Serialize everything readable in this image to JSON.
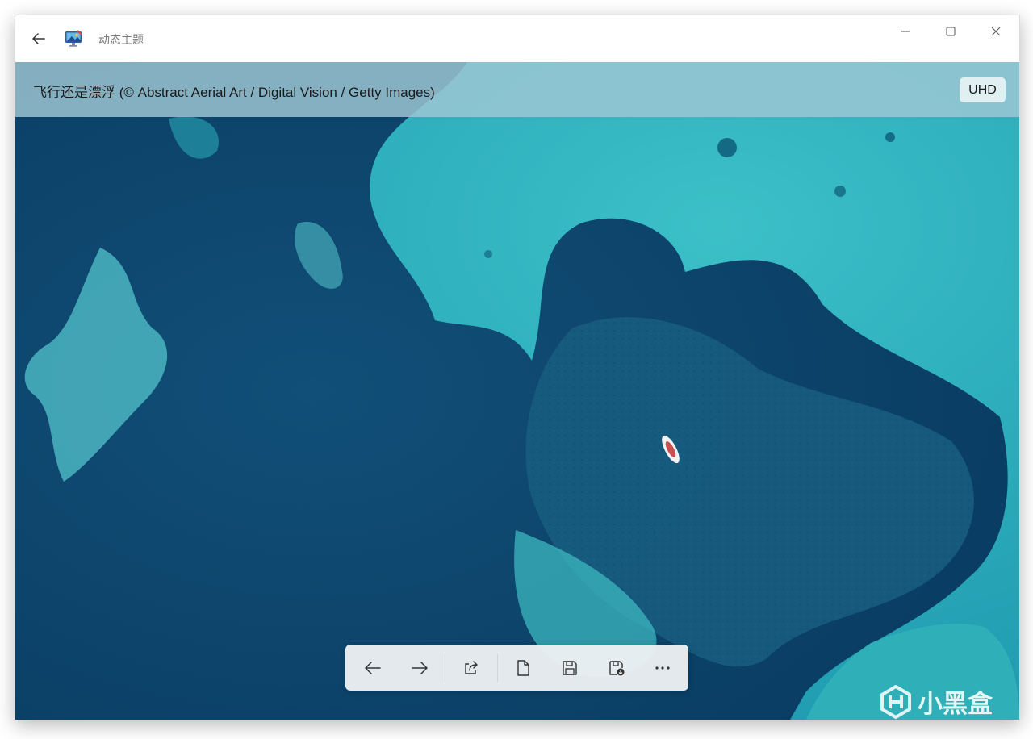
{
  "window": {
    "title": "动态主题"
  },
  "image_info": {
    "title": "飞行还是漂浮 (© Abstract Aerial Art / Digital Vision / Getty Images)",
    "badge": "UHD"
  },
  "toolbar": {
    "buttons": [
      {
        "icon": "arrow-left-icon",
        "name": "previous-button"
      },
      {
        "icon": "arrow-right-icon",
        "name": "next-button"
      },
      {
        "icon": "share-icon",
        "name": "share-button"
      },
      {
        "icon": "file-icon",
        "name": "file-button"
      },
      {
        "icon": "save-icon",
        "name": "save-button"
      },
      {
        "icon": "save-as-icon",
        "name": "save-as-button"
      },
      {
        "icon": "more-icon",
        "name": "more-button"
      }
    ]
  },
  "watermark": {
    "text": "小黑盒"
  },
  "colors": {
    "deep_water": "#0d4c74",
    "shallow_water": "#2aa7b8",
    "info_bar": "#a0c8d4"
  }
}
